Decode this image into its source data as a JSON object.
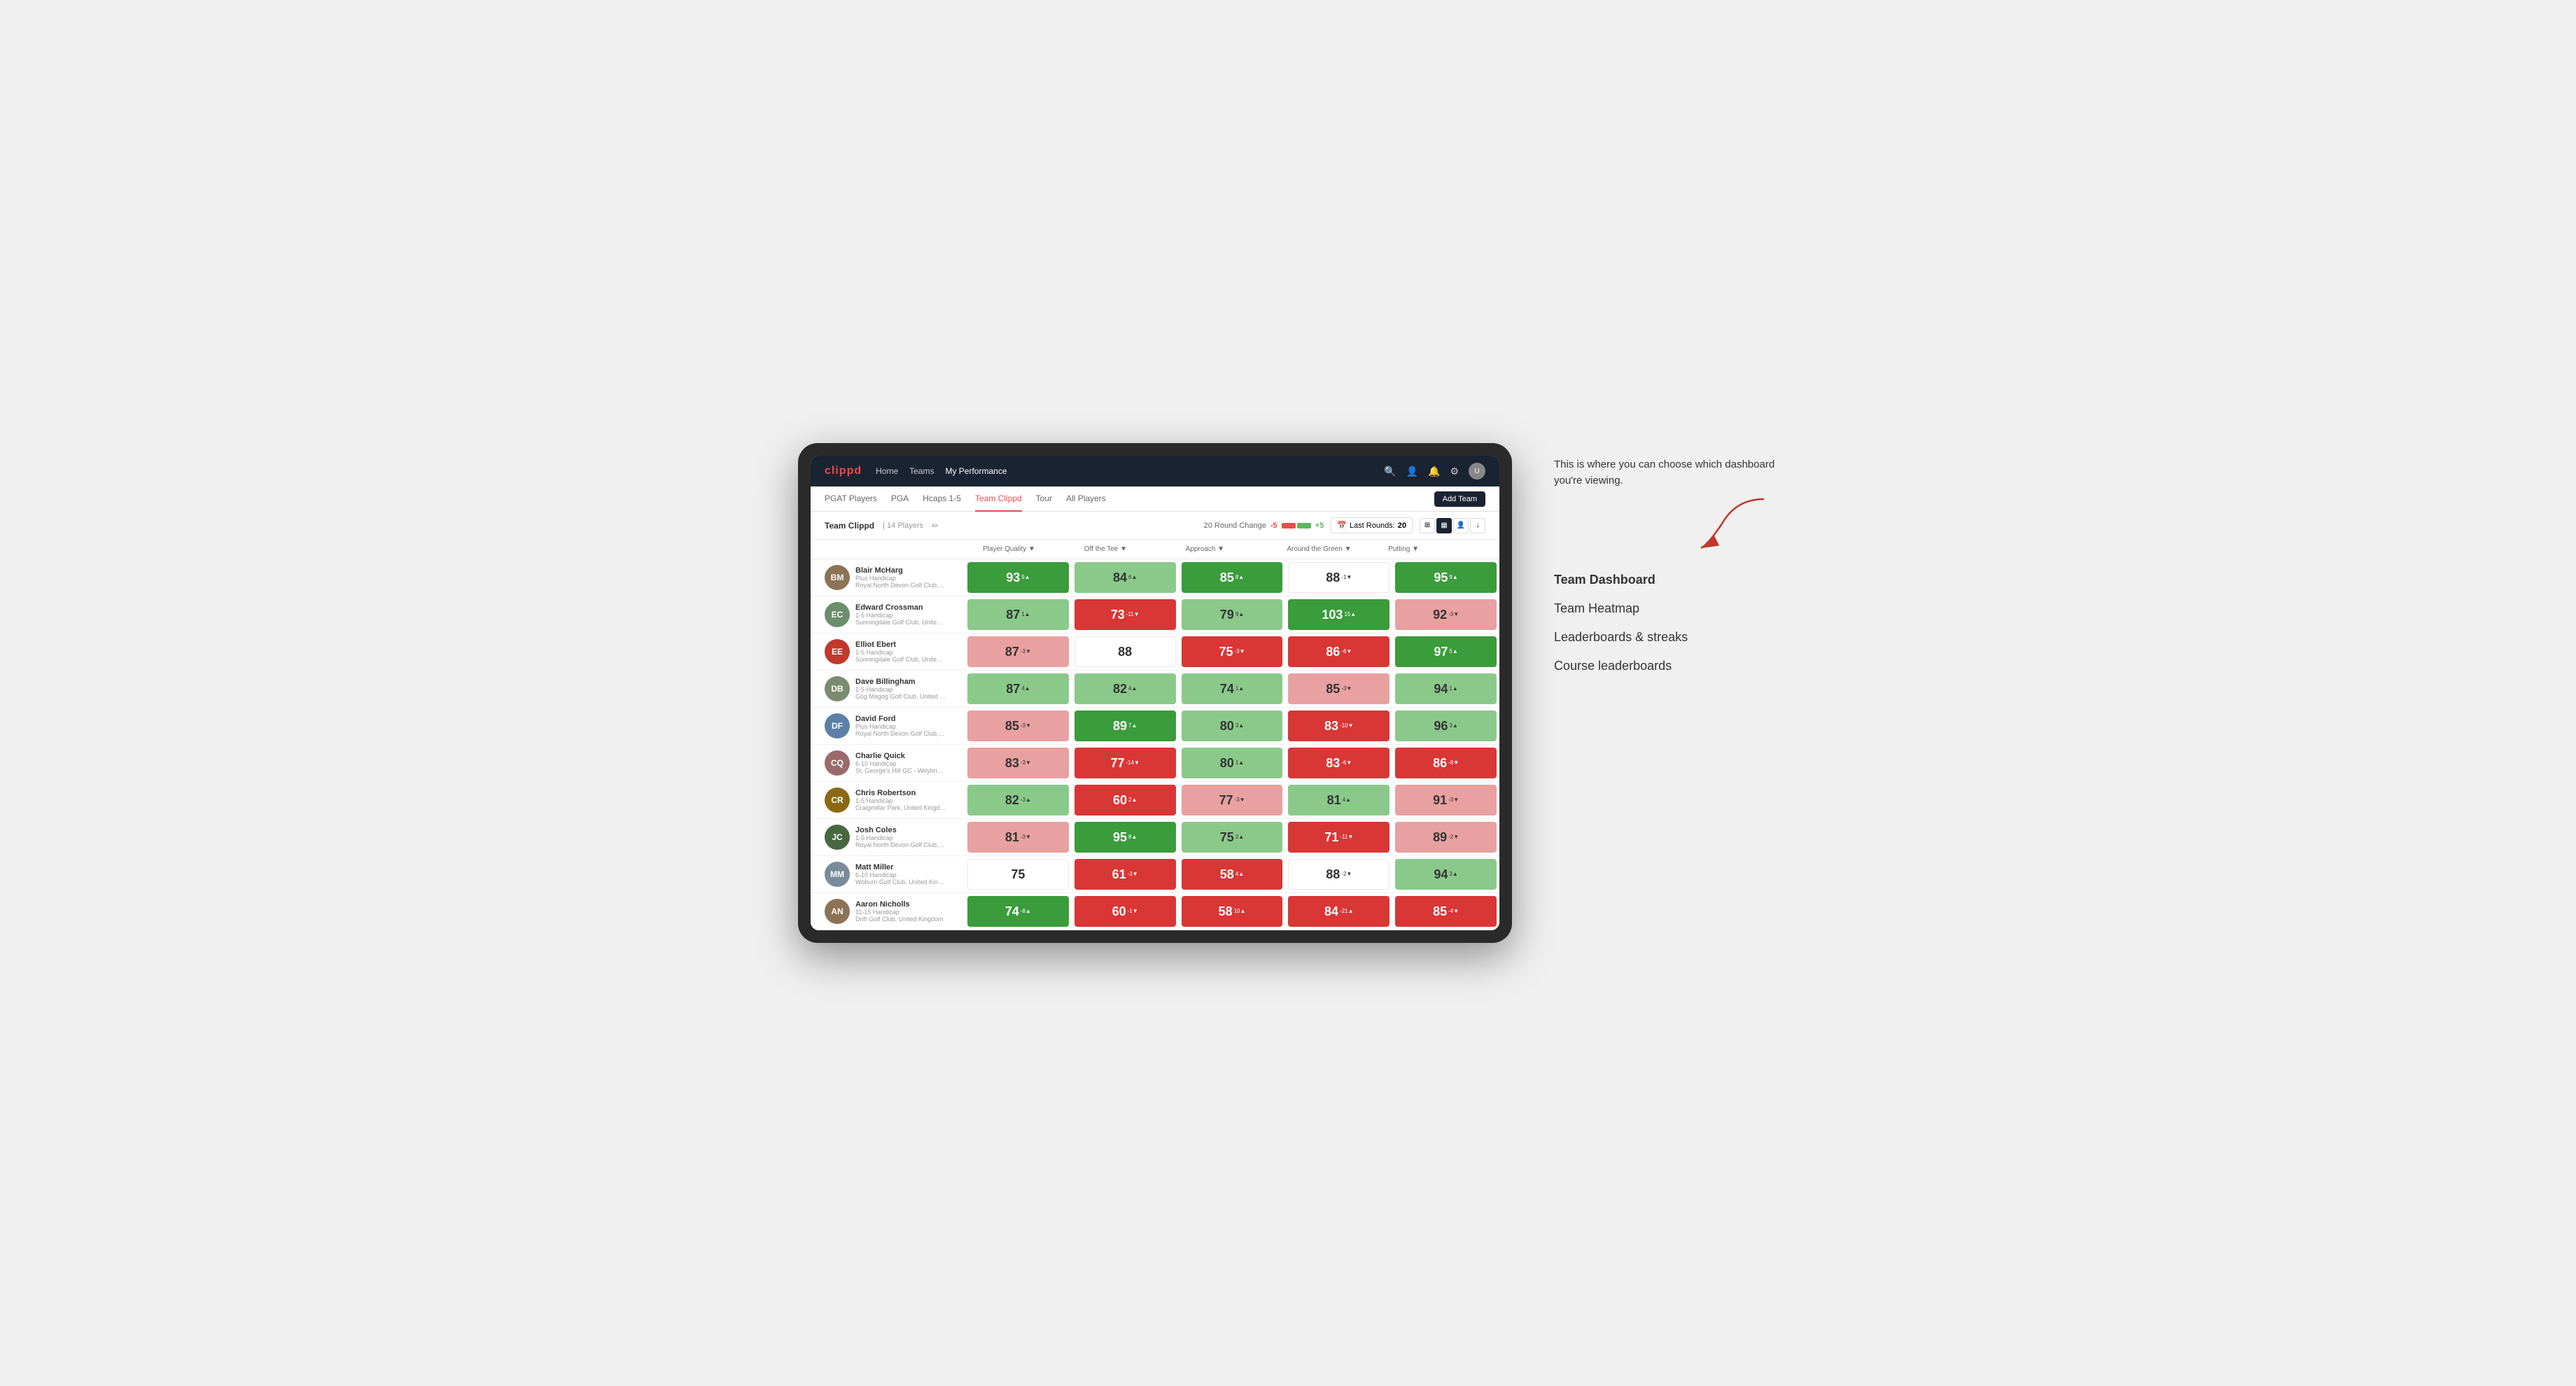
{
  "annotation": {
    "intro_text": "This is where you can choose which dashboard you're viewing.",
    "items": [
      {
        "id": "team-dashboard",
        "label": "Team Dashboard",
        "active": true
      },
      {
        "id": "team-heatmap",
        "label": "Team Heatmap",
        "active": false
      },
      {
        "id": "leaderboards-streaks",
        "label": "Leaderboards & streaks",
        "active": false
      },
      {
        "id": "course-leaderboards",
        "label": "Course leaderboards",
        "active": false
      }
    ]
  },
  "nav": {
    "logo": "clippd",
    "links": [
      {
        "label": "Home",
        "active": false
      },
      {
        "label": "Teams",
        "active": false
      },
      {
        "label": "My Performance",
        "active": true
      }
    ],
    "icons": [
      "🔍",
      "👤",
      "🔔",
      "⚙"
    ]
  },
  "tabs": [
    {
      "label": "PGAT Players",
      "active": false
    },
    {
      "label": "PGA",
      "active": false
    },
    {
      "label": "Hcaps 1-5",
      "active": false
    },
    {
      "label": "Team Clippd",
      "active": true
    },
    {
      "label": "Tour",
      "active": false
    },
    {
      "label": "All Players",
      "active": false
    }
  ],
  "add_team_label": "Add Team",
  "toolbar": {
    "team_name": "Team Clippd",
    "player_count": "14 Players",
    "round_change_label": "20 Round Change",
    "round_change_min": "-5",
    "round_change_max": "+5",
    "last_rounds_label": "Last Rounds:",
    "last_rounds_value": "20"
  },
  "table": {
    "columns": [
      "Player Quality ▼",
      "Off the Tee ▼",
      "Approach ▼",
      "Around the Green ▼",
      "Putting ▼"
    ],
    "rows": [
      {
        "name": "Blair McHarg",
        "handicap": "Plus Handicap",
        "club": "Royal North Devon Golf Club, United Kingdom",
        "avatar_color": "#8B7355",
        "avatar_initials": "BM",
        "scores": [
          {
            "value": "93",
            "change": "9▲",
            "bg": "bg-green-dark"
          },
          {
            "value": "84",
            "change": "6▲",
            "bg": "bg-green-light"
          },
          {
            "value": "85",
            "change": "8▲",
            "bg": "bg-green-dark"
          },
          {
            "value": "88",
            "change": "-1▼",
            "bg": "bg-white"
          },
          {
            "value": "95",
            "change": "9▲",
            "bg": "bg-green-dark"
          }
        ]
      },
      {
        "name": "Edward Crossman",
        "handicap": "1-5 Handicap",
        "club": "Sunningdale Golf Club, United Kingdom",
        "avatar_color": "#6B8E6B",
        "avatar_initials": "EC",
        "scores": [
          {
            "value": "87",
            "change": "1▲",
            "bg": "bg-green-light"
          },
          {
            "value": "73",
            "change": "-11▼",
            "bg": "bg-red-dark"
          },
          {
            "value": "79",
            "change": "9▲",
            "bg": "bg-green-light"
          },
          {
            "value": "103",
            "change": "15▲",
            "bg": "bg-green-dark"
          },
          {
            "value": "92",
            "change": "-3▼",
            "bg": "bg-red-light"
          }
        ]
      },
      {
        "name": "Elliot Ebert",
        "handicap": "1-5 Handicap",
        "club": "Sunningdale Golf Club, United Kingdom",
        "avatar_color": "#c0392b",
        "avatar_initials": "EE",
        "scores": [
          {
            "value": "87",
            "change": "-3▼",
            "bg": "bg-red-light"
          },
          {
            "value": "88",
            "change": "",
            "bg": "bg-white"
          },
          {
            "value": "75",
            "change": "-3▼",
            "bg": "bg-red-dark"
          },
          {
            "value": "86",
            "change": "-6▼",
            "bg": "bg-red-dark"
          },
          {
            "value": "97",
            "change": "5▲",
            "bg": "bg-green-dark"
          }
        ]
      },
      {
        "name": "Dave Billingham",
        "handicap": "1-5 Handicap",
        "club": "Gog Magog Golf Club, United Kingdom",
        "avatar_color": "#7B8B6F",
        "avatar_initials": "DB",
        "scores": [
          {
            "value": "87",
            "change": "4▲",
            "bg": "bg-green-light"
          },
          {
            "value": "82",
            "change": "4▲",
            "bg": "bg-green-light"
          },
          {
            "value": "74",
            "change": "1▲",
            "bg": "bg-green-light"
          },
          {
            "value": "85",
            "change": "-3▼",
            "bg": "bg-red-light"
          },
          {
            "value": "94",
            "change": "1▲",
            "bg": "bg-green-light"
          }
        ]
      },
      {
        "name": "David Ford",
        "handicap": "Plus Handicap",
        "club": "Royal North Devon Golf Club, United Kingdom",
        "avatar_color": "#5B7FA6",
        "avatar_initials": "DF",
        "scores": [
          {
            "value": "85",
            "change": "-3▼",
            "bg": "bg-red-light"
          },
          {
            "value": "89",
            "change": "7▲",
            "bg": "bg-green-dark"
          },
          {
            "value": "80",
            "change": "3▲",
            "bg": "bg-green-light"
          },
          {
            "value": "83",
            "change": "-10▼",
            "bg": "bg-red-dark"
          },
          {
            "value": "96",
            "change": "3▲",
            "bg": "bg-green-light"
          }
        ]
      },
      {
        "name": "Charlie Quick",
        "handicap": "6-10 Handicap",
        "club": "St. George's Hill GC - Weybridge - Surrey, Uni...",
        "avatar_color": "#9B6B6B",
        "avatar_initials": "CQ",
        "scores": [
          {
            "value": "83",
            "change": "-3▼",
            "bg": "bg-red-light"
          },
          {
            "value": "77",
            "change": "-14▼",
            "bg": "bg-red-dark"
          },
          {
            "value": "80",
            "change": "1▲",
            "bg": "bg-green-light"
          },
          {
            "value": "83",
            "change": "-6▼",
            "bg": "bg-red-dark"
          },
          {
            "value": "86",
            "change": "-8▼",
            "bg": "bg-red-dark"
          }
        ]
      },
      {
        "name": "Chris Robertson",
        "handicap": "1-5 Handicap",
        "club": "Craigmillar Park, United Kingdom",
        "avatar_color": "#8B6914",
        "avatar_initials": "CR",
        "scores": [
          {
            "value": "82",
            "change": "-3▲",
            "bg": "bg-green-light"
          },
          {
            "value": "60",
            "change": "2▲",
            "bg": "bg-red-dark"
          },
          {
            "value": "77",
            "change": "-3▼",
            "bg": "bg-red-light"
          },
          {
            "value": "81",
            "change": "4▲",
            "bg": "bg-green-light"
          },
          {
            "value": "91",
            "change": "-3▼",
            "bg": "bg-red-light"
          }
        ]
      },
      {
        "name": "Josh Coles",
        "handicap": "1-5 Handicap",
        "club": "Royal North Devon Golf Club, United Kingdom",
        "avatar_color": "#4A6741",
        "avatar_initials": "JC",
        "scores": [
          {
            "value": "81",
            "change": "-3▼",
            "bg": "bg-red-light"
          },
          {
            "value": "95",
            "change": "8▲",
            "bg": "bg-green-dark"
          },
          {
            "value": "75",
            "change": "2▲",
            "bg": "bg-green-light"
          },
          {
            "value": "71",
            "change": "-11▼",
            "bg": "bg-red-dark"
          },
          {
            "value": "89",
            "change": "-2▼",
            "bg": "bg-red-light"
          }
        ]
      },
      {
        "name": "Matt Miller",
        "handicap": "6-10 Handicap",
        "club": "Woburn Golf Club, United Kingdom",
        "avatar_color": "#7A8B9A",
        "avatar_initials": "MM",
        "scores": [
          {
            "value": "75",
            "change": "",
            "bg": "bg-white"
          },
          {
            "value": "61",
            "change": "-3▼",
            "bg": "bg-red-dark"
          },
          {
            "value": "58",
            "change": "4▲",
            "bg": "bg-red-dark"
          },
          {
            "value": "88",
            "change": "-2▼",
            "bg": "bg-white"
          },
          {
            "value": "94",
            "change": "3▲",
            "bg": "bg-green-light"
          }
        ]
      },
      {
        "name": "Aaron Nicholls",
        "handicap": "11-15 Handicap",
        "club": "Drift Golf Club, United Kingdom",
        "avatar_color": "#8B7355",
        "avatar_initials": "AN",
        "scores": [
          {
            "value": "74",
            "change": "-8▲",
            "bg": "bg-green-dark"
          },
          {
            "value": "60",
            "change": "-1▼",
            "bg": "bg-red-dark"
          },
          {
            "value": "58",
            "change": "10▲",
            "bg": "bg-red-dark"
          },
          {
            "value": "84",
            "change": "-21▲",
            "bg": "bg-red-dark"
          },
          {
            "value": "85",
            "change": "-4▼",
            "bg": "bg-red-dark"
          }
        ]
      }
    ]
  }
}
